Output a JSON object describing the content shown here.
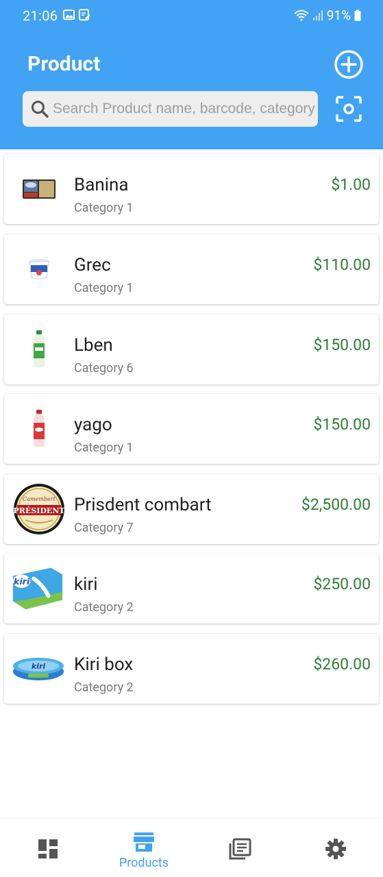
{
  "status_bar": {
    "time": "21:06",
    "battery": "91%",
    "icons": [
      "gallery-icon",
      "note-icon",
      "wifi-icon",
      "signal-icon",
      "battery-icon"
    ]
  },
  "header": {
    "title": "Product",
    "add_icon": "add-circle-icon",
    "scan_icon": "barcode-scan-icon",
    "background_color": "#42a2f3"
  },
  "search": {
    "placeholder": "Search Product name, barcode, category",
    "value": ""
  },
  "products": [
    {
      "name": "Banina",
      "category": "Category 1",
      "price": "$1.00"
    },
    {
      "name": "Grec",
      "category": "Category 1",
      "price": "$110.00"
    },
    {
      "name": "Lben",
      "category": "Category 6",
      "price": "$150.00"
    },
    {
      "name": "yago",
      "category": "Category 1",
      "price": "$150.00"
    },
    {
      "name": "Prisdent combart",
      "category": "Category 7",
      "price": "$2,500.00"
    },
    {
      "name": "kiri",
      "category": "Category 2",
      "price": "$250.00"
    },
    {
      "name": "Kiri box",
      "category": "Category 2",
      "price": "$260.00"
    }
  ],
  "product_image_labels": {
    "president_top": "Camembert",
    "president_main": "PRÉSIDENT",
    "kiri": "kiri",
    "kiri_box": "kiri"
  },
  "bottom_nav": {
    "items": [
      {
        "id": "dashboard",
        "icon": "dashboard-icon",
        "label": ""
      },
      {
        "id": "products",
        "icon": "store-icon",
        "label": "Products",
        "active": true
      },
      {
        "id": "records",
        "icon": "library-books-icon",
        "label": ""
      },
      {
        "id": "settings",
        "icon": "gear-icon",
        "label": ""
      }
    ]
  },
  "colors": {
    "accent": "#42a2f3",
    "price": "#2e7d32",
    "nav_inactive": "#555555"
  }
}
